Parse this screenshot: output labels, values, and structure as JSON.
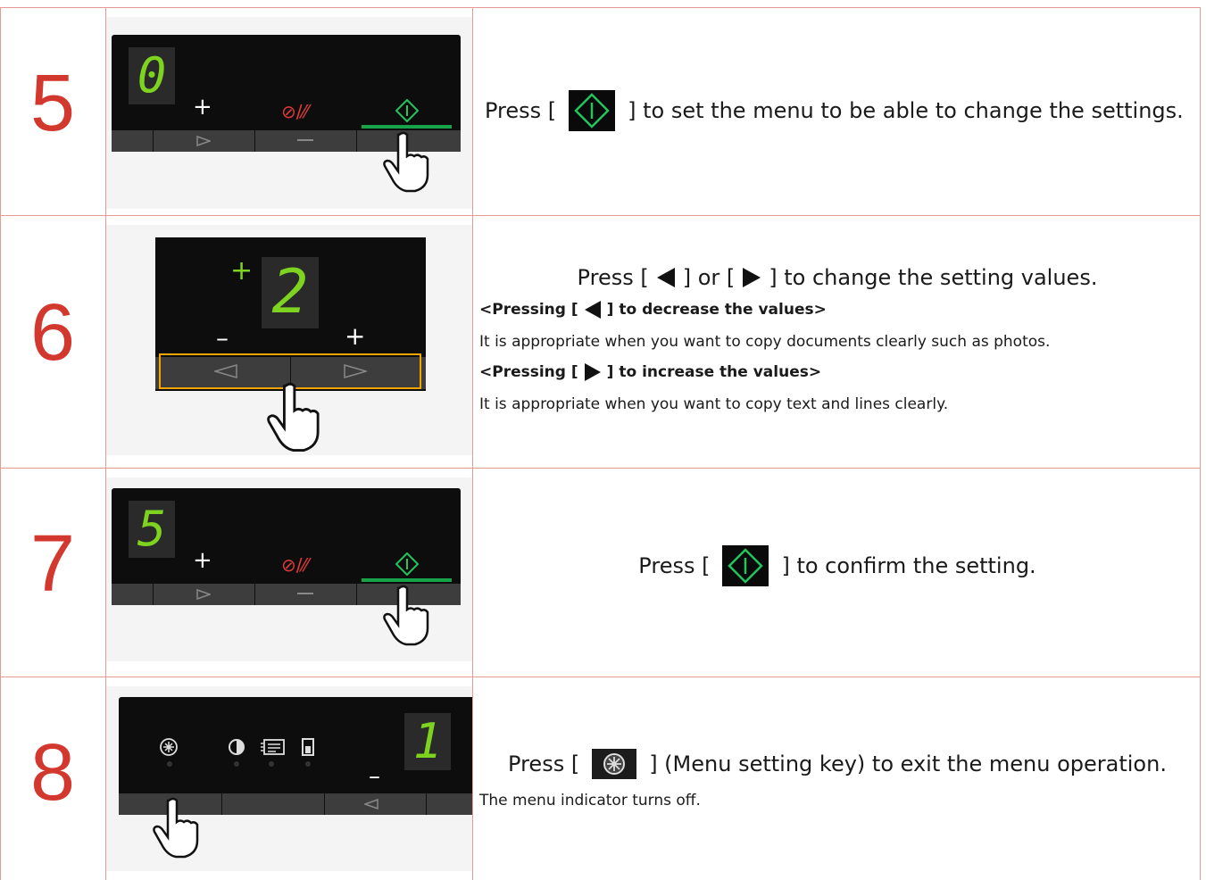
{
  "steps": [
    {
      "number": "5",
      "main_before": "Press [",
      "main_after": "] to set the menu to be able to change the settings.",
      "panel": {
        "display": "0",
        "plus": "+",
        "clear": "⊘/⁄⁄"
      }
    },
    {
      "number": "6",
      "main_before": "Press [",
      "main_mid": "] or [",
      "main_after": "] to change the setting values.",
      "sub1_before": "<Pressing [",
      "sub1_after": "] to decrease the values>",
      "note1": "It is appropriate when you want to copy documents clearly such as photos.",
      "sub2_before": "<Pressing [",
      "sub2_after": "] to increase the values>",
      "note2": "It is appropriate when you want to copy text and lines clearly.",
      "panel": {
        "display": "2",
        "plus": "+",
        "minus": "–",
        "plus2": "+"
      }
    },
    {
      "number": "7",
      "main_before": "Press [",
      "main_after": "] to confirm the setting.",
      "panel": {
        "display": "5",
        "plus": "+",
        "clear": "⊘/⁄⁄"
      }
    },
    {
      "number": "8",
      "main_before": "Press [",
      "main_after": "] (Menu setting key) to exit the menu operation.",
      "note1": "The menu indicator turns off.",
      "panel": {
        "display": "1",
        "minus": "–"
      }
    }
  ],
  "colors": {
    "number": "#d3382e",
    "border": "#e39b93",
    "led": "#7ed321",
    "start_green": "#16a34a",
    "highlight": "#f0a500"
  },
  "icons": [
    "start-icon",
    "left-arrow-icon",
    "right-arrow-icon",
    "menu-setting-icon",
    "pointing-hand-icon"
  ]
}
